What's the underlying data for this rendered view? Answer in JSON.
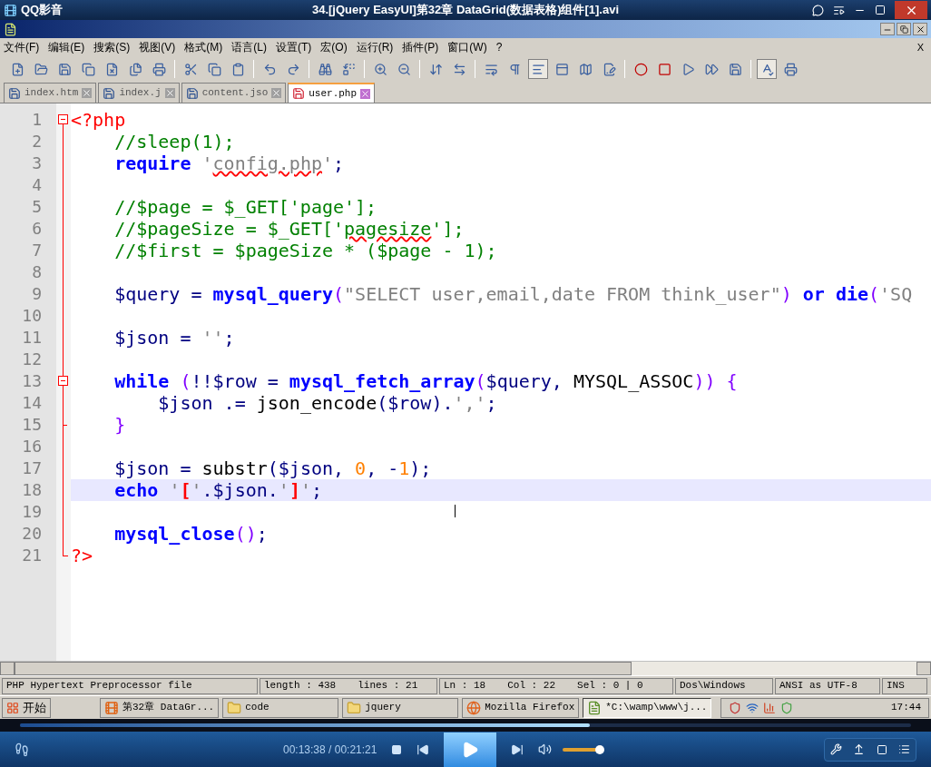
{
  "player": {
    "app_name": "QQ影音",
    "title": "34.[jQuery EasyUI]第32章 DataGrid(数据表格)组件[1].avi"
  },
  "menu": [
    "文件(F)",
    "编辑(E)",
    "搜索(S)",
    "视图(V)",
    "格式(M)",
    "语言(L)",
    "设置(T)",
    "宏(O)",
    "运行(R)",
    "插件(P)",
    "窗口(W)",
    "?"
  ],
  "menu_close": "X",
  "toolbar": [
    {
      "pressed": false
    },
    {
      "pressed": false
    },
    {
      "pressed": false
    },
    {
      "pressed": false
    },
    {
      "pressed": false
    },
    {
      "pressed": false
    },
    {
      "pressed": false
    },
    {
      "pressed": false
    },
    {
      "pressed": false
    },
    {
      "pressed": false
    },
    {
      "pressed": false
    },
    {
      "pressed": false
    },
    {
      "pressed": false
    },
    {
      "pressed": false
    },
    {
      "pressed": false
    },
    {
      "pressed": false
    },
    {
      "pressed": false
    },
    {
      "pressed": false
    },
    {
      "pressed": false
    },
    {
      "pressed": false
    },
    {
      "pressed": true
    },
    {
      "pressed": false
    },
    {
      "pressed": false
    },
    {
      "pressed": false
    },
    {
      "pressed": false
    },
    {
      "pressed": false
    },
    {
      "pressed": false
    },
    {
      "pressed": false
    },
    {
      "pressed": false
    },
    {
      "pressed": true
    },
    {
      "pressed": false
    }
  ],
  "tabs": [
    {
      "label": "index.htm",
      "selected": false,
      "modified": false
    },
    {
      "label": "index.j",
      "selected": false,
      "modified": false
    },
    {
      "label": "content.jso",
      "selected": false,
      "modified": false
    },
    {
      "label": "user.php",
      "selected": true,
      "modified": true
    }
  ],
  "lines": [
    {
      "number": "1",
      "kind": "fold_start",
      "current": false,
      "tokens": [
        {
          "kind": "tag",
          "text": "<?php"
        }
      ]
    },
    {
      "number": "2",
      "kind": "fold_body",
      "current": false,
      "tokens": [
        {
          "kind": "comment",
          "text": "    //sleep(1);"
        }
      ]
    },
    {
      "number": "3",
      "kind": "fold_body",
      "current": false,
      "tokens": [
        {
          "kind": "keyword",
          "text": "    require "
        },
        {
          "kind": "string",
          "text": "'"
        },
        {
          "kind": "misspelled_string",
          "text": "config.php"
        },
        {
          "kind": "string",
          "text": "'"
        },
        {
          "kind": "op",
          "text": ";"
        }
      ]
    },
    {
      "number": "4",
      "kind": "fold_body",
      "current": false
    },
    {
      "number": "5",
      "kind": "fold_body",
      "current": false,
      "tokens": [
        {
          "kind": "comment",
          "text": "    //$page = $_GET['page'];"
        }
      ]
    },
    {
      "number": "6",
      "kind": "fold_body",
      "current": false,
      "tokens": [
        {
          "kind": "comment",
          "text": "    //$pageSize = $_GET['"
        },
        {
          "kind": "misspelled_comment",
          "text": "pagesize"
        },
        {
          "kind": "comment",
          "text": "'];"
        }
      ]
    },
    {
      "number": "7",
      "kind": "fold_body",
      "current": false,
      "tokens": [
        {
          "kind": "comment",
          "text": "    //$first = $pageSize * ($page - 1);"
        }
      ]
    },
    {
      "number": "8",
      "kind": "fold_body",
      "current": false
    },
    {
      "number": "9",
      "kind": "fold_body",
      "current": false,
      "tokens": [
        {
          "kind": "var",
          "text": "    $query"
        },
        {
          "kind": "op",
          "text": " = "
        },
        {
          "kind": "keyword",
          "text": "mysql_query"
        },
        {
          "kind": "paren",
          "text": "("
        },
        {
          "kind": "string",
          "text": "\"SELECT user,email,date FROM think_user\""
        },
        {
          "kind": "paren",
          "text": ") "
        },
        {
          "kind": "keyword",
          "text": "or die"
        },
        {
          "kind": "paren",
          "text": "("
        },
        {
          "kind": "string",
          "text": "'SQ"
        }
      ]
    },
    {
      "number": "10",
      "kind": "fold_body",
      "current": false
    },
    {
      "number": "11",
      "kind": "fold_body",
      "current": false,
      "tokens": [
        {
          "kind": "var",
          "text": "    $json"
        },
        {
          "kind": "op",
          "text": " = "
        },
        {
          "kind": "string",
          "text": "''"
        },
        {
          "kind": "op",
          "text": ";"
        }
      ]
    },
    {
      "number": "12",
      "kind": "fold_body",
      "current": false
    },
    {
      "number": "13",
      "kind": "fold_start",
      "current": false,
      "tokens": [
        {
          "kind": "keyword",
          "text": "    while "
        },
        {
          "kind": "paren",
          "text": "("
        },
        {
          "kind": "op",
          "text": "!!"
        },
        {
          "kind": "var",
          "text": "$row"
        },
        {
          "kind": "op",
          "text": " = "
        },
        {
          "kind": "keyword",
          "text": "mysql_fetch_array"
        },
        {
          "kind": "paren",
          "text": "("
        },
        {
          "kind": "var",
          "text": "$query"
        },
        {
          "kind": "op",
          "text": ", "
        },
        {
          "kind": "plain",
          "text": "MYSQL_ASSOC"
        },
        {
          "kind": "paren",
          "text": ")) {"
        }
      ]
    },
    {
      "number": "14",
      "kind": "fold_body",
      "current": false,
      "tokens": [
        {
          "kind": "var",
          "text": "        $json"
        },
        {
          "kind": "op",
          "text": " .= "
        },
        {
          "kind": "plain",
          "text": "json_encode"
        },
        {
          "kind": "op",
          "text": "("
        },
        {
          "kind": "var",
          "text": "$row"
        },
        {
          "kind": "op",
          "text": ")."
        },
        {
          "kind": "string",
          "text": "','"
        },
        {
          "kind": "op",
          "text": ";"
        }
      ]
    },
    {
      "number": "15",
      "kind": "fold_end_inner",
      "current": false,
      "tokens": [
        {
          "kind": "paren",
          "text": "    }"
        }
      ]
    },
    {
      "number": "16",
      "kind": "fold_body",
      "current": false
    },
    {
      "number": "17",
      "kind": "fold_body",
      "current": false,
      "tokens": [
        {
          "kind": "var",
          "text": "    $json"
        },
        {
          "kind": "op",
          "text": " = "
        },
        {
          "kind": "plain",
          "text": "substr"
        },
        {
          "kind": "op",
          "text": "("
        },
        {
          "kind": "var",
          "text": "$json"
        },
        {
          "kind": "op",
          "text": ", "
        },
        {
          "kind": "number",
          "text": "0"
        },
        {
          "kind": "op",
          "text": ", -"
        },
        {
          "kind": "number",
          "text": "1"
        },
        {
          "kind": "op",
          "text": ");"
        }
      ]
    },
    {
      "number": "18",
      "kind": "fold_body",
      "current": true,
      "tokens": [
        {
          "kind": "keyword",
          "text": "    echo "
        },
        {
          "kind": "string",
          "text": "'"
        },
        {
          "kind": "brace",
          "text": "["
        },
        {
          "kind": "string",
          "text": "'"
        },
        {
          "kind": "op",
          "text": "."
        },
        {
          "kind": "var",
          "text": "$json"
        },
        {
          "kind": "op",
          "text": "."
        },
        {
          "kind": "string",
          "text": "'"
        },
        {
          "kind": "brace",
          "text": "]"
        },
        {
          "kind": "string",
          "text": "'"
        },
        {
          "kind": "op",
          "text": ";"
        }
      ]
    },
    {
      "number": "19",
      "kind": "fold_body",
      "current": false
    },
    {
      "number": "20",
      "kind": "fold_body",
      "current": false,
      "tokens": [
        {
          "kind": "keyword",
          "text": "    mysql_close"
        },
        {
          "kind": "paren",
          "text": "()"
        },
        {
          "kind": "op",
          "text": ";"
        }
      ]
    },
    {
      "number": "21",
      "kind": "fold_end",
      "current": false,
      "tokens": [
        {
          "kind": "tag",
          "text": "?>"
        }
      ]
    }
  ],
  "status_bar": [
    {
      "parts": [
        "PHP Hypertext Preprocessor file"
      ]
    },
    {
      "parts": [
        "length : 438",
        "lines : 21"
      ]
    },
    {
      "parts": [
        "Ln : 18",
        "Col : 22",
        "Sel : 0 | 0"
      ]
    },
    {
      "parts": [
        "Dos\\Windows"
      ]
    },
    {
      "parts": [
        "ANSI as UTF-8"
      ]
    },
    {
      "parts": [
        "INS"
      ]
    }
  ],
  "taskbar": {
    "start": "开始",
    "tasks": [
      {
        "label": "第32章 DataGr...",
        "kind": "player",
        "selected": false
      },
      {
        "label": "code",
        "kind": "folder",
        "selected": false
      },
      {
        "label": "jquery",
        "kind": "folder",
        "selected": false
      },
      {
        "label": "Mozilla Firefox",
        "kind": "browser",
        "selected": false
      },
      {
        "label": "*C:\\wamp\\www\\j...",
        "kind": "notepad",
        "selected": true
      }
    ],
    "clock": "17:44"
  },
  "playback": {
    "level": 0.64,
    "time": "00:13:38 / 00:21:21",
    "volume": {
      "level": 0.93
    }
  }
}
